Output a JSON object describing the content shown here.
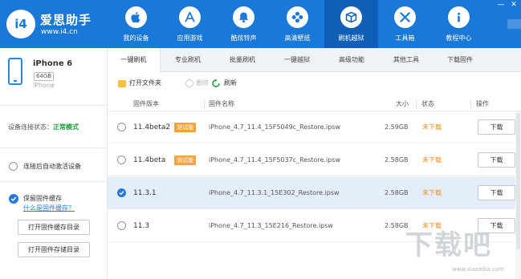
{
  "app": {
    "logo_mark": "i4",
    "name": "爱思助手",
    "url": "www.i4.cn"
  },
  "nav": [
    {
      "label": "我的设备",
      "icon": "apple-icon"
    },
    {
      "label": "应用游戏",
      "icon": "app-store-icon"
    },
    {
      "label": "酷炫铃声",
      "icon": "bell-icon"
    },
    {
      "label": "高清壁纸",
      "icon": "flower-icon"
    },
    {
      "label": "刷机越狱",
      "icon": "box-icon",
      "active": true
    },
    {
      "label": "工具箱",
      "icon": "tools-icon"
    },
    {
      "label": "教程中心",
      "icon": "info-icon"
    }
  ],
  "window": {
    "minimize": "—",
    "close": "✕"
  },
  "device": {
    "name": "iPhone 6",
    "capacity": "64GB",
    "model": "iPhone"
  },
  "sidebar": {
    "status_label": "设备连接状态：",
    "status_value": "正常模式",
    "auto_activate_label": "连接后自动激活设备",
    "keep_firmware_label": "保留固件缓存",
    "what_is_cache_link": "什么是固件缓存？",
    "open_cache_dir": "打开固件缓存目录",
    "open_storage_dir": "打开固件存储目录"
  },
  "tabs": [
    "一键刷机",
    "专业刷机",
    "批量刷机",
    "一键越狱",
    "高级功能",
    "其他工具",
    "下载固件"
  ],
  "toolbar": {
    "open_folder": "打开文件夹",
    "delete": "删除",
    "refresh": "刷新"
  },
  "table": {
    "headers": [
      "固件版本",
      "固件名称",
      "大小",
      "状态",
      "操作"
    ],
    "rows": [
      {
        "version": "11.4beta2",
        "beta": "测试版",
        "name": "iPhone_4.7_11.4_15F5049c_Restore.ipsw",
        "size": "2.59GB",
        "status": "未下载",
        "action": "下载",
        "selected": false
      },
      {
        "version": "11.4beta",
        "beta": "测试版",
        "name": "iPhone_4.7_11.4_15F5037c_Restore.ipsw",
        "size": "2.58GB",
        "status": "未下载",
        "action": "下载",
        "selected": false
      },
      {
        "version": "11.3.1",
        "beta": "",
        "name": "iPhone_4.7_11.3.1_15E302_Restore.ipsw",
        "size": "2.58GB",
        "status": "未下载",
        "action": "下载",
        "selected": true
      },
      {
        "version": "11.3",
        "beta": "",
        "name": "iPhone_4.7_11.3_15E216_Restore.ipsw",
        "size": "2.58GB",
        "status": "未下载",
        "action": "下载",
        "selected": false
      }
    ]
  },
  "watermark": {
    "text": "下载吧",
    "url": "www.xiazaiba.com"
  },
  "colors": {
    "header": "#1a78d9",
    "header_active": "#0f5fb6",
    "status_ok": "#1b9c38",
    "not_downloaded": "#f08a1c",
    "beta_tag": "#f3a33a",
    "selected_row": "#e4eefb"
  }
}
